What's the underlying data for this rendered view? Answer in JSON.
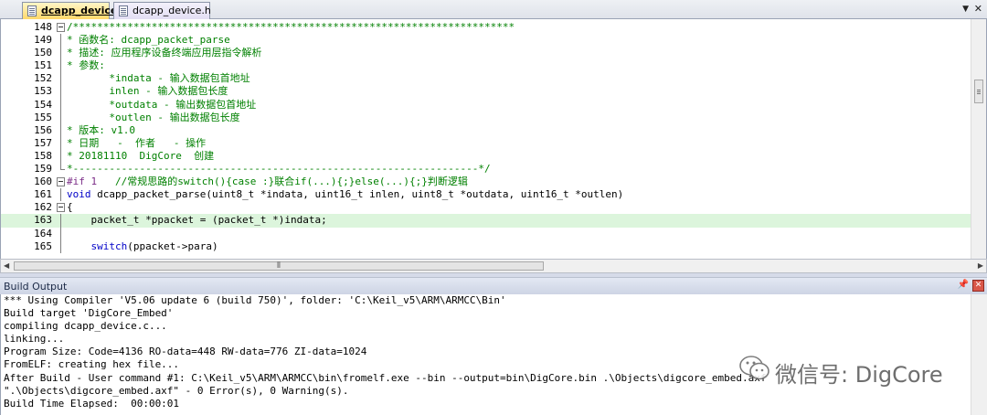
{
  "tabs": [
    {
      "label": "dcapp_device.c",
      "active": true
    },
    {
      "label": "dcapp_device.h",
      "active": false
    }
  ],
  "tab_controls": {
    "dropdown_icon": "chevron-down-icon",
    "close_icon": "close-icon"
  },
  "editor": {
    "lines": [
      {
        "num": "148",
        "text": "/*************************************************************************"
      },
      {
        "num": "149",
        "text": "* 函数名: dcapp_packet_parse"
      },
      {
        "num": "150",
        "text": "* 描述: 应用程序设备终端应用层指令解析"
      },
      {
        "num": "151",
        "text": "* 参数:"
      },
      {
        "num": "152",
        "text": "       *indata - 输入数据包首地址"
      },
      {
        "num": "153",
        "text": "       inlen - 输入数据包长度"
      },
      {
        "num": "154",
        "text": "       *outdata - 输出数据包首地址"
      },
      {
        "num": "155",
        "text": "       *outlen - 输出数据包长度"
      },
      {
        "num": "156",
        "text": "* 版本: v1.0"
      },
      {
        "num": "157",
        "text": "* 日期   -  作者   - 操作"
      },
      {
        "num": "158",
        "text": "* 20181110  DigCore  创建"
      },
      {
        "num": "159",
        "text": "*-------------------------------------------------------------------*/"
      },
      {
        "num": "160",
        "pp": "#if 1",
        "text": "   //常规思路的switch(){case :}联合if(...){;}else(...){;}判断逻辑"
      },
      {
        "num": "161",
        "kw": "void",
        "text": " dcapp_packet_parse(uint8_t *indata, uint16_t inlen, uint8_t *outdata, uint16_t *outlen)"
      },
      {
        "num": "162",
        "text": "{"
      },
      {
        "num": "163",
        "text": "    packet_t *ppacket = (packet_t *)indata;"
      },
      {
        "num": "164",
        "text": ""
      },
      {
        "num": "165",
        "kw": "    switch",
        "text": "(ppacket->para)"
      }
    ],
    "highlight_line": "163"
  },
  "build_output": {
    "title": "Build Output",
    "lines": [
      "*** Using Compiler 'V5.06 update 6 (build 750)', folder: 'C:\\Keil_v5\\ARM\\ARMCC\\Bin'",
      "Build target 'DigCore_Embed'",
      "compiling dcapp_device.c...",
      "linking...",
      "Program Size: Code=4136 RO-data=448 RW-data=776 ZI-data=1024",
      "FromELF: creating hex file...",
      "After Build - User command #1: C:\\Keil_v5\\ARM\\ARMCC\\bin\\fromelf.exe --bin --output=bin\\DigCore.bin .\\Objects\\digcore_embed.axf",
      "\".\\Objects\\digcore_embed.axf\" - 0 Error(s), 0 Warning(s).",
      "Build Time Elapsed:  00:00:01"
    ]
  },
  "watermark": {
    "text": "微信号: DigCore"
  },
  "colors": {
    "comment": "#008000",
    "keyword": "#0000c8",
    "preprocessor": "#7a2b86",
    "highlight": "#dcf5dc",
    "active_tab": "#ffd86a"
  }
}
